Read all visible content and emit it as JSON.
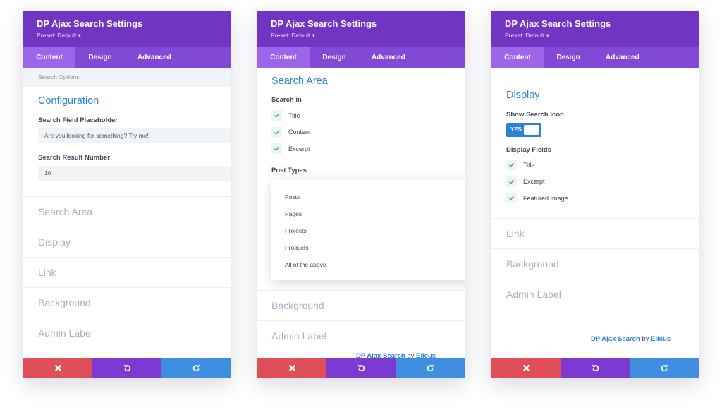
{
  "panels": [
    {
      "title": "DP Ajax Search Settings",
      "preset": "Preset: Default ▾",
      "tabs": [
        "Content",
        "Design",
        "Advanced"
      ],
      "subbar": "Search Options",
      "section": "Configuration",
      "fields": [
        {
          "label": "Search Field Placeholder",
          "value": "Are you looking for something? Try me!"
        },
        {
          "label": "Search Result Number",
          "value": "10"
        }
      ],
      "collapsed": [
        "Search Area",
        "Display",
        "Link",
        "Background",
        "Admin Label"
      ]
    },
    {
      "title": "DP Ajax Search Settings",
      "preset": "Preset: Default ▾",
      "tabs": [
        "Content",
        "Design",
        "Advanced"
      ],
      "section": "Search Area",
      "search_in_label": "Search in",
      "search_in": [
        "Title",
        "Content",
        "Excerpt"
      ],
      "post_types_label": "Post Types",
      "post_types_options": [
        "Posts",
        "Pages",
        "Projects",
        "Products",
        "All of the above"
      ],
      "collapsed": [
        "Background",
        "Admin Label"
      ],
      "credit": {
        "name": "DP Ajax Search",
        "by": "by",
        "author": "Elicus"
      }
    },
    {
      "title": "DP Ajax Search Settings",
      "preset": "Preset: Default ▾",
      "tabs": [
        "Content",
        "Design",
        "Advanced"
      ],
      "section": "Display",
      "show_icon_label": "Show Search Icon",
      "toggle_value": "YES",
      "display_fields_label": "Display Fields",
      "display_fields": [
        "Title",
        "Excerpt",
        "Featured Image"
      ],
      "collapsed": [
        "Link",
        "Background",
        "Admin Label"
      ],
      "credit": {
        "name": "DP Ajax Search",
        "by": "by",
        "author": "Elicus"
      }
    }
  ],
  "icons": {
    "close": "close-icon",
    "undo": "undo-icon",
    "redo": "redo-icon",
    "check": "check-icon"
  },
  "colors": {
    "header": "#7135c4",
    "tabs": "#8248d6",
    "active_tab": "#9d66ea",
    "accent": "#2a81d6",
    "cancel": "#e04e59",
    "undo": "#7b3bd0",
    "save": "#3f8ee0"
  }
}
